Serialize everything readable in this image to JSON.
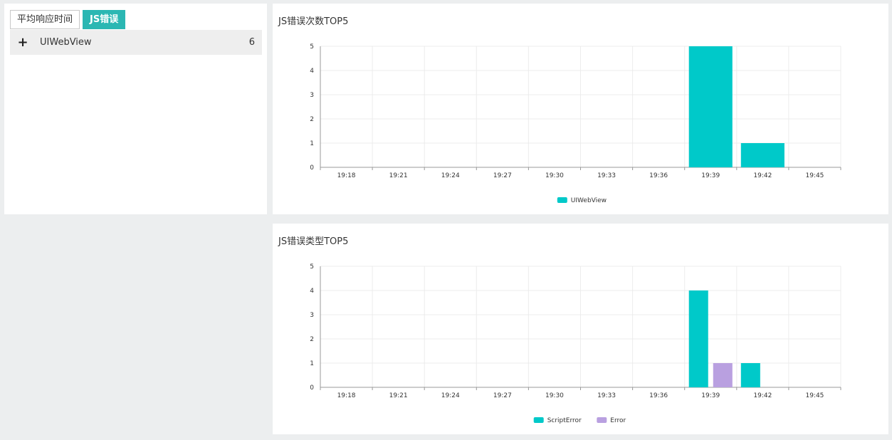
{
  "tabs": {
    "avg_response": "平均响应时间",
    "js_error": "JS错误"
  },
  "list": {
    "items": [
      {
        "label": "UIWebView",
        "count": "6"
      }
    ]
  },
  "chart_data": [
    {
      "title": "JS错误次数TOP5",
      "type": "bar",
      "categories": [
        "19:18",
        "19:21",
        "19:24",
        "19:27",
        "19:30",
        "19:33",
        "19:36",
        "19:39",
        "19:42",
        "19:45"
      ],
      "ylim": [
        0,
        5
      ],
      "yticks": [
        "0",
        "1",
        "2",
        "3",
        "4",
        "5"
      ],
      "grid": true,
      "legend_position": "bottom-center",
      "series": [
        {
          "name": "UIWebView",
          "color": "#00c9c9",
          "values": [
            0,
            0,
            0,
            0,
            0,
            0,
            0,
            5,
            1,
            0
          ]
        }
      ]
    },
    {
      "title": "JS错误类型TOP5",
      "type": "bar",
      "categories": [
        "19:18",
        "19:21",
        "19:24",
        "19:27",
        "19:30",
        "19:33",
        "19:36",
        "19:39",
        "19:42",
        "19:45"
      ],
      "ylim": [
        0,
        5
      ],
      "yticks": [
        "0",
        "1",
        "2",
        "3",
        "4",
        "5"
      ],
      "grid": true,
      "legend_position": "bottom-center",
      "series": [
        {
          "name": "ScriptError",
          "color": "#00c9c9",
          "values": [
            0,
            0,
            0,
            0,
            0,
            0,
            0,
            4,
            1,
            0
          ]
        },
        {
          "name": "Error",
          "color": "#b9a0e0",
          "values": [
            0,
            0,
            0,
            0,
            0,
            0,
            0,
            1,
            0,
            0
          ]
        }
      ]
    }
  ]
}
